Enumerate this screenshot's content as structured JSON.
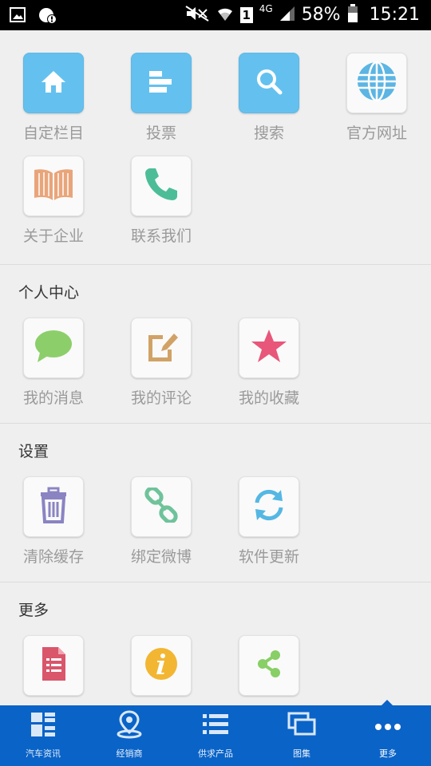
{
  "status_bar": {
    "battery_percent": "58%",
    "time": "15:21",
    "sim_label": "1",
    "network": "4G"
  },
  "top_grid": [
    {
      "label": "自定栏目",
      "icon": "home-icon"
    },
    {
      "label": "投票",
      "icon": "vote-bars-icon"
    },
    {
      "label": "搜索",
      "icon": "search-icon"
    },
    {
      "label": "官方网址",
      "icon": "globe-icon"
    },
    {
      "label": "关于企业",
      "icon": "book-icon"
    },
    {
      "label": "联系我们",
      "icon": "phone-icon"
    }
  ],
  "sections": [
    {
      "title": "个人中心",
      "items": [
        {
          "label": "我的消息",
          "icon": "speech-bubble-icon"
        },
        {
          "label": "我的评论",
          "icon": "edit-note-icon"
        },
        {
          "label": "我的收藏",
          "icon": "star-icon"
        }
      ]
    },
    {
      "title": "设置",
      "items": [
        {
          "label": "清除缓存",
          "icon": "trash-icon"
        },
        {
          "label": "绑定微博",
          "icon": "link-icon"
        },
        {
          "label": "软件更新",
          "icon": "refresh-icon"
        }
      ]
    },
    {
      "title": "更多",
      "items": [
        {
          "label": "",
          "icon": "document-icon"
        },
        {
          "label": "",
          "icon": "info-icon"
        },
        {
          "label": "",
          "icon": "share-icon"
        }
      ]
    }
  ],
  "bottom_nav": [
    {
      "label": "汽车资讯",
      "icon": "grid-list-icon"
    },
    {
      "label": "经销商",
      "icon": "location-pin-icon"
    },
    {
      "label": "供求产品",
      "icon": "list-icon"
    },
    {
      "label": "图集",
      "icon": "gallery-icon"
    },
    {
      "label": "更多",
      "icon": "more-dots-icon",
      "active": true
    }
  ],
  "colors": {
    "accent_blue": "#64c1ef",
    "nav_blue": "#0a63c7",
    "star": "#e8567a",
    "phone": "#4dbd97",
    "bubble": "#8ccf6a",
    "book": "#e9a57a",
    "trash": "#8a84c2",
    "link": "#6fc39a",
    "refresh": "#55b7e3",
    "doc": "#d9566b",
    "info": "#f2b632",
    "share": "#88cf66"
  }
}
